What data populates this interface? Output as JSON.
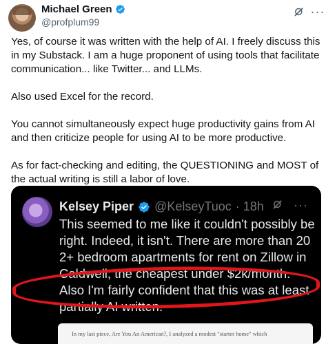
{
  "author": {
    "name": "Michael Green",
    "handle": "@profplum99",
    "verified": true
  },
  "post": {
    "paragraphs": [
      "Yes, of course it was written with the help of AI. I freely discuss this in my Substack. I am a huge proponent of using tools that facilitate communication... like Twitter... and LLMs.",
      "Also used Excel for the record.",
      "You cannot simultaneously expect huge productivity gains from AI and then criticize people for using AI to be more productive.",
      "As for fact-checking and editing, the QUESTIONING and MOST of the actual writing is still a labor of love."
    ]
  },
  "quoted": {
    "name": "Kelsey Piper",
    "handle": "@KelseyTuoc",
    "time": "· 18h",
    "text": "This seemed to me like it couldn't possibly be right. Indeed, it isn't. There are more than 20 2+ bedroom apartments for rent on Zillow in Caldwell, the cheapest under $2k/month. Also I'm fairly confident that this was at least partially AI written.",
    "preview_text": "In my last piece, Are You An American?, I analyzed a modest \"starter home\" which"
  },
  "colors": {
    "verified_blue": "#1d9bf0",
    "highlight_red": "#e0161b",
    "quote_bg": "#000000"
  },
  "icons": {
    "grok": "grok-icon",
    "more": "more-icon",
    "verified": "verified-badge-icon"
  }
}
